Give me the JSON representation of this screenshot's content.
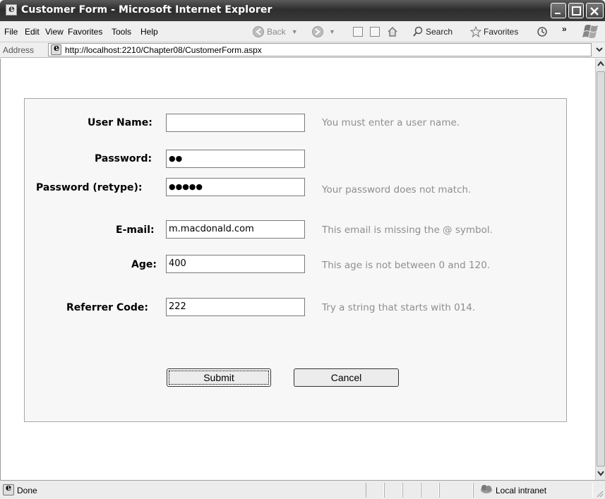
{
  "window": {
    "title": "Customer Form - Microsoft Internet Explorer"
  },
  "menu": {
    "file": "File",
    "edit": "Edit",
    "view": "View",
    "favorites": "Favorites",
    "tools": "Tools",
    "help": "Help"
  },
  "toolbar": {
    "back": "Back",
    "search": "Search",
    "favorites": "Favorites",
    "chevron": "»"
  },
  "address": {
    "label": "Address",
    "url": "http://localhost:2210/Chapter08/CustomerForm.aspx"
  },
  "form": {
    "username": {
      "label": "User Name:",
      "value": "",
      "message": "You must enter a user name."
    },
    "password": {
      "label": "Password:",
      "value": "●●",
      "message": ""
    },
    "password_retype": {
      "label": "Password (retype):",
      "value": "●●●●●",
      "message": "Your password does not match."
    },
    "email": {
      "label": "E-mail:",
      "value": "m.macdonald.com",
      "message": "This email is missing the @ symbol."
    },
    "age": {
      "label": "Age:",
      "value": "400",
      "message": "This age is not between 0 and 120."
    },
    "referrer": {
      "label": "Referrer Code:",
      "value": "222",
      "message": "Try a string that starts with 014."
    },
    "submit_label": "Submit",
    "cancel_label": "Cancel"
  },
  "status": {
    "text": "Done",
    "zone": "Local intranet"
  }
}
